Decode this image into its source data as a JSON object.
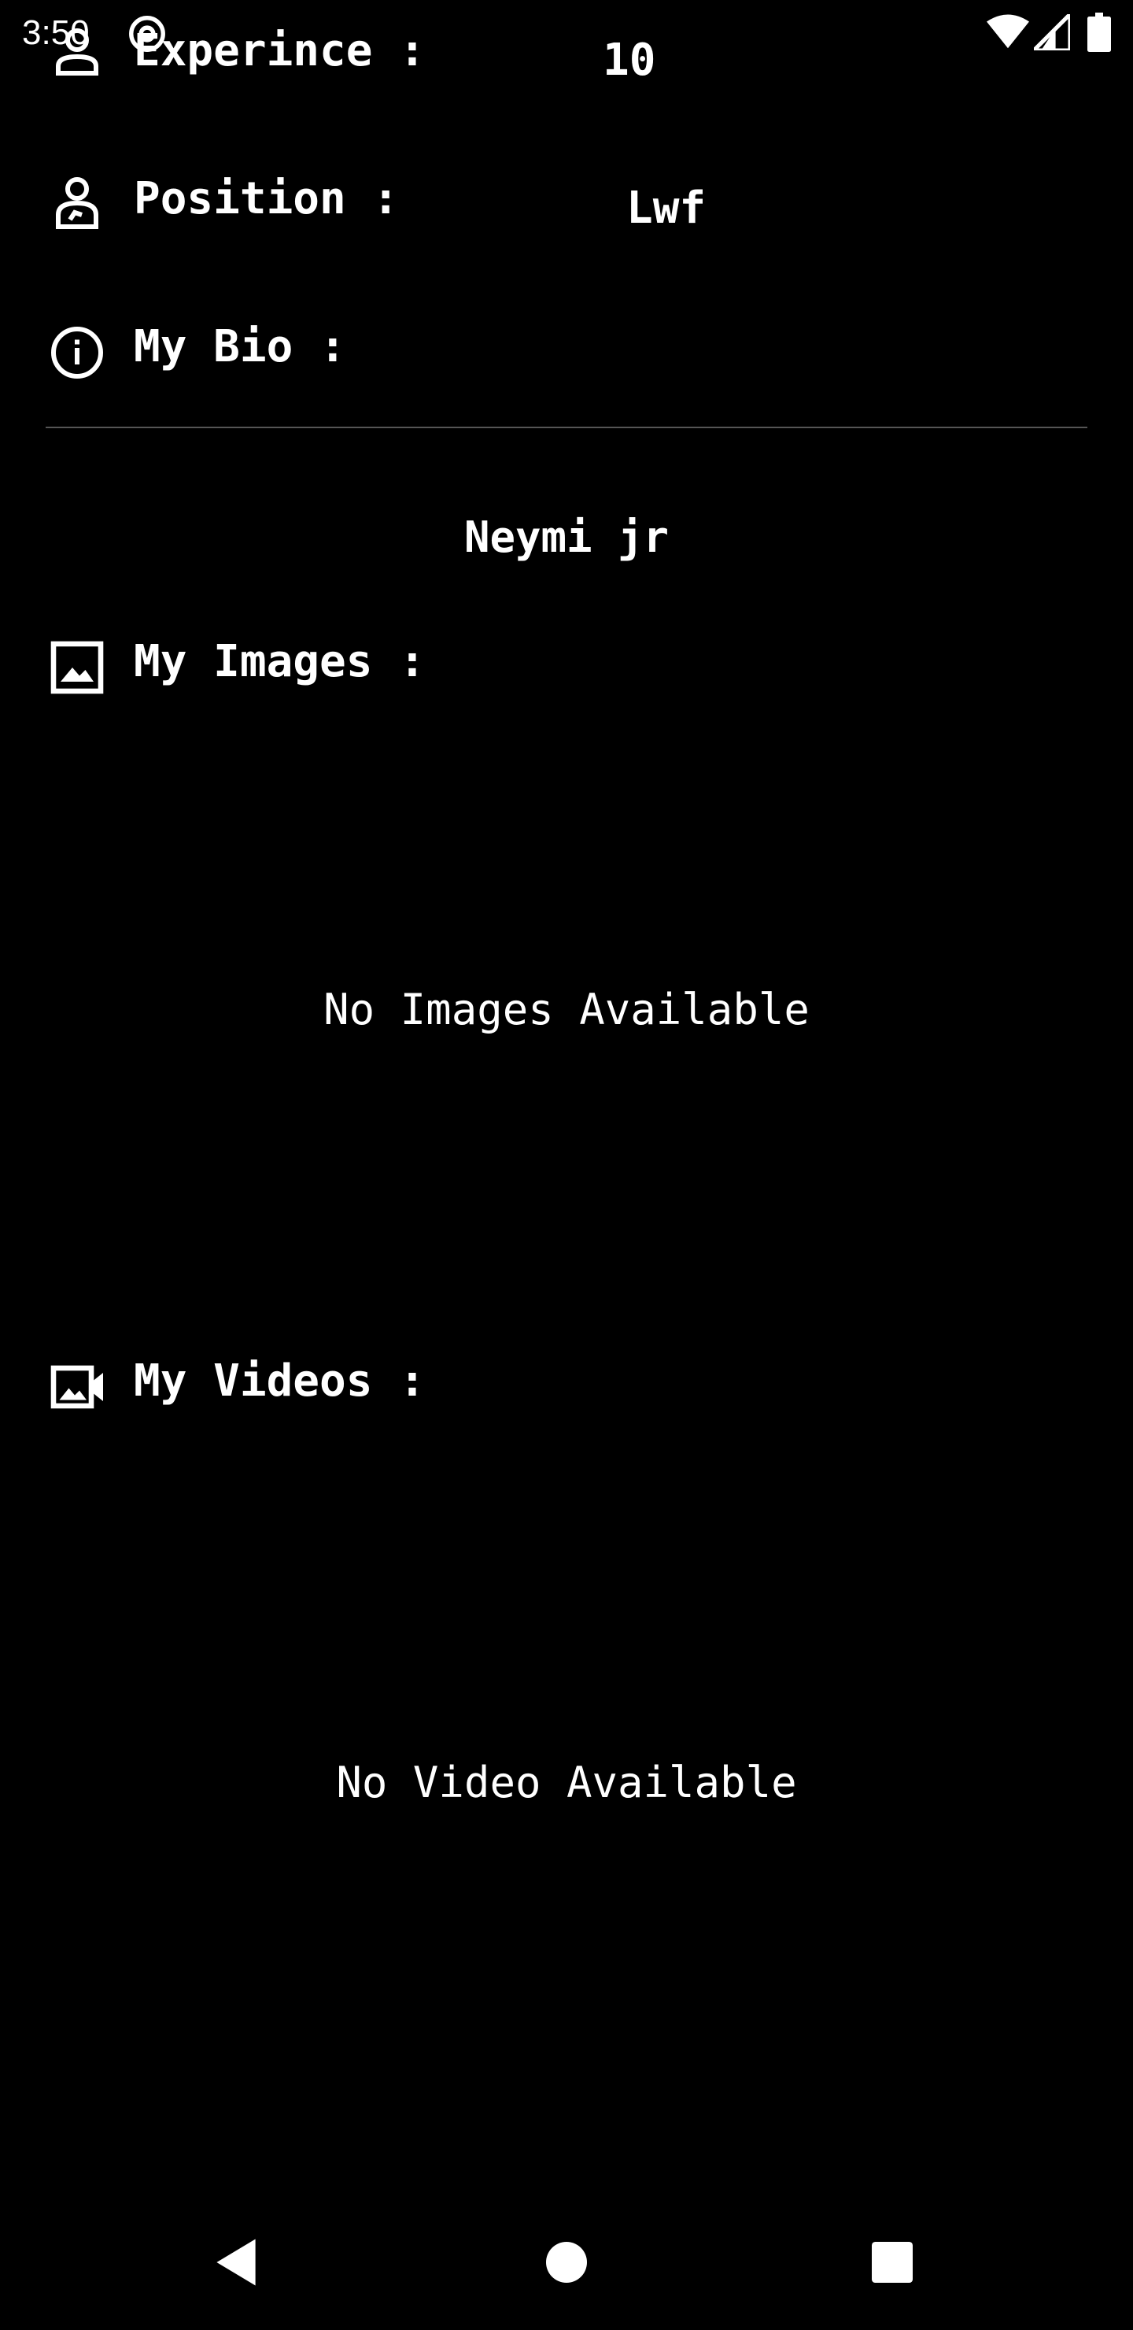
{
  "status_bar": {
    "time": "3:50",
    "icons": [
      "at-sign-icon",
      "wifi-icon",
      "cell-signal-icon",
      "battery-icon"
    ]
  },
  "profile": {
    "experience": {
      "label": "Experince :",
      "value": "10",
      "icon": "person-icon"
    },
    "position": {
      "label": "Position :",
      "value": "Lwf",
      "icon": "person-badge-icon"
    },
    "bio": {
      "label": "My Bio :",
      "value": "",
      "icon": "info-icon"
    }
  },
  "name": "Neymi jr",
  "images_section": {
    "label": "My Images :",
    "icon": "image-icon",
    "empty_text": "No Images Available"
  },
  "videos_section": {
    "label": "My Videos :",
    "icon": "video-icon",
    "empty_text": "No Video Available"
  },
  "nav_bar": {
    "icons": [
      "back-icon",
      "home-icon",
      "recents-icon"
    ]
  }
}
